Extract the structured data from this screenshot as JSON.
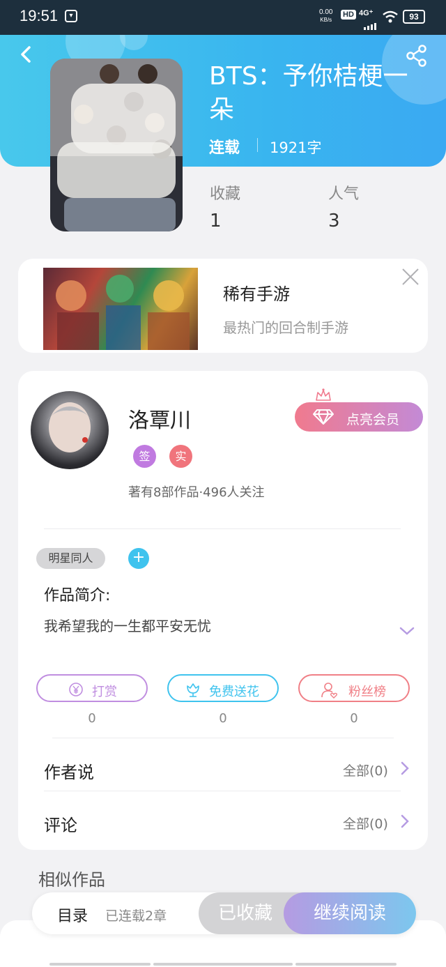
{
  "status_bar": {
    "time": "19:51",
    "net_speed_value": "0.00",
    "net_speed_unit": "KB/s",
    "hd": "HD",
    "network": "4G⁺",
    "battery": "93"
  },
  "header": {
    "title": "BTS：予你桔梗一朵",
    "status": "连载",
    "word_count": "1921字",
    "stats": [
      {
        "label": "收藏",
        "value": "1"
      },
      {
        "label": "人气",
        "value": "3"
      }
    ],
    "accent_color": "#3ab5ef"
  },
  "ad": {
    "title": "稀有手游",
    "subtitle": "最热门的回合制手游"
  },
  "author": {
    "name": "洛覃川",
    "badges": [
      "签",
      "实"
    ],
    "info": "著有8部作品·496人关注",
    "vip_label": "点亮会员"
  },
  "work": {
    "genre_tag": "明星同人",
    "plus": "+",
    "intro_label": "作品简介:",
    "intro_text": "我希望我的一生都平安无忧"
  },
  "actions": [
    {
      "label": "打赏",
      "icon": "yen-icon",
      "count": "0",
      "color": "#c08ee0"
    },
    {
      "label": "免费送花",
      "icon": "flower-icon",
      "count": "0",
      "color": "#3fc3ee"
    },
    {
      "label": "粉丝榜",
      "icon": "fan-icon",
      "count": "0",
      "color": "#f07f86"
    }
  ],
  "rows": [
    {
      "label": "作者说",
      "value": "全部(0)"
    },
    {
      "label": "评论",
      "value": "全部(0)"
    }
  ],
  "similar_title": "相似作品",
  "bottom_bar": {
    "toc_label": "目录",
    "toc_sub": "已连载2章",
    "favorited_label": "已收藏",
    "read_label": "继续阅读"
  }
}
